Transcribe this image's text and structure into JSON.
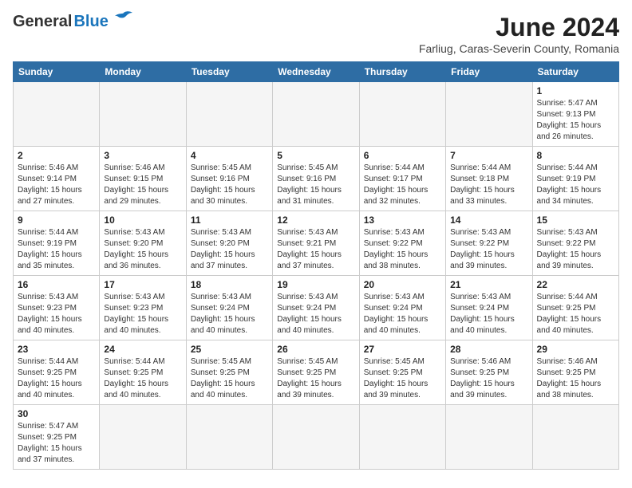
{
  "header": {
    "logo_general": "General",
    "logo_blue": "Blue",
    "month_title": "June 2024",
    "subtitle": "Farliug, Caras-Severin County, Romania"
  },
  "weekdays": [
    "Sunday",
    "Monday",
    "Tuesday",
    "Wednesday",
    "Thursday",
    "Friday",
    "Saturday"
  ],
  "weeks": [
    [
      {
        "day": "",
        "info": ""
      },
      {
        "day": "",
        "info": ""
      },
      {
        "day": "",
        "info": ""
      },
      {
        "day": "",
        "info": ""
      },
      {
        "day": "",
        "info": ""
      },
      {
        "day": "",
        "info": ""
      },
      {
        "day": "1",
        "info": "Sunrise: 5:47 AM\nSunset: 9:13 PM\nDaylight: 15 hours\nand 26 minutes."
      }
    ],
    [
      {
        "day": "2",
        "info": "Sunrise: 5:46 AM\nSunset: 9:14 PM\nDaylight: 15 hours\nand 27 minutes."
      },
      {
        "day": "3",
        "info": "Sunrise: 5:46 AM\nSunset: 9:15 PM\nDaylight: 15 hours\nand 29 minutes."
      },
      {
        "day": "4",
        "info": "Sunrise: 5:45 AM\nSunset: 9:16 PM\nDaylight: 15 hours\nand 30 minutes."
      },
      {
        "day": "5",
        "info": "Sunrise: 5:45 AM\nSunset: 9:16 PM\nDaylight: 15 hours\nand 31 minutes."
      },
      {
        "day": "6",
        "info": "Sunrise: 5:44 AM\nSunset: 9:17 PM\nDaylight: 15 hours\nand 32 minutes."
      },
      {
        "day": "7",
        "info": "Sunrise: 5:44 AM\nSunset: 9:18 PM\nDaylight: 15 hours\nand 33 minutes."
      },
      {
        "day": "8",
        "info": "Sunrise: 5:44 AM\nSunset: 9:19 PM\nDaylight: 15 hours\nand 34 minutes."
      }
    ],
    [
      {
        "day": "9",
        "info": "Sunrise: 5:44 AM\nSunset: 9:19 PM\nDaylight: 15 hours\nand 35 minutes."
      },
      {
        "day": "10",
        "info": "Sunrise: 5:43 AM\nSunset: 9:20 PM\nDaylight: 15 hours\nand 36 minutes."
      },
      {
        "day": "11",
        "info": "Sunrise: 5:43 AM\nSunset: 9:20 PM\nDaylight: 15 hours\nand 37 minutes."
      },
      {
        "day": "12",
        "info": "Sunrise: 5:43 AM\nSunset: 9:21 PM\nDaylight: 15 hours\nand 37 minutes."
      },
      {
        "day": "13",
        "info": "Sunrise: 5:43 AM\nSunset: 9:22 PM\nDaylight: 15 hours\nand 38 minutes."
      },
      {
        "day": "14",
        "info": "Sunrise: 5:43 AM\nSunset: 9:22 PM\nDaylight: 15 hours\nand 39 minutes."
      },
      {
        "day": "15",
        "info": "Sunrise: 5:43 AM\nSunset: 9:22 PM\nDaylight: 15 hours\nand 39 minutes."
      }
    ],
    [
      {
        "day": "16",
        "info": "Sunrise: 5:43 AM\nSunset: 9:23 PM\nDaylight: 15 hours\nand 40 minutes."
      },
      {
        "day": "17",
        "info": "Sunrise: 5:43 AM\nSunset: 9:23 PM\nDaylight: 15 hours\nand 40 minutes."
      },
      {
        "day": "18",
        "info": "Sunrise: 5:43 AM\nSunset: 9:24 PM\nDaylight: 15 hours\nand 40 minutes."
      },
      {
        "day": "19",
        "info": "Sunrise: 5:43 AM\nSunset: 9:24 PM\nDaylight: 15 hours\nand 40 minutes."
      },
      {
        "day": "20",
        "info": "Sunrise: 5:43 AM\nSunset: 9:24 PM\nDaylight: 15 hours\nand 40 minutes."
      },
      {
        "day": "21",
        "info": "Sunrise: 5:43 AM\nSunset: 9:24 PM\nDaylight: 15 hours\nand 40 minutes."
      },
      {
        "day": "22",
        "info": "Sunrise: 5:44 AM\nSunset: 9:25 PM\nDaylight: 15 hours\nand 40 minutes."
      }
    ],
    [
      {
        "day": "23",
        "info": "Sunrise: 5:44 AM\nSunset: 9:25 PM\nDaylight: 15 hours\nand 40 minutes."
      },
      {
        "day": "24",
        "info": "Sunrise: 5:44 AM\nSunset: 9:25 PM\nDaylight: 15 hours\nand 40 minutes."
      },
      {
        "day": "25",
        "info": "Sunrise: 5:45 AM\nSunset: 9:25 PM\nDaylight: 15 hours\nand 40 minutes."
      },
      {
        "day": "26",
        "info": "Sunrise: 5:45 AM\nSunset: 9:25 PM\nDaylight: 15 hours\nand 39 minutes."
      },
      {
        "day": "27",
        "info": "Sunrise: 5:45 AM\nSunset: 9:25 PM\nDaylight: 15 hours\nand 39 minutes."
      },
      {
        "day": "28",
        "info": "Sunrise: 5:46 AM\nSunset: 9:25 PM\nDaylight: 15 hours\nand 39 minutes."
      },
      {
        "day": "29",
        "info": "Sunrise: 5:46 AM\nSunset: 9:25 PM\nDaylight: 15 hours\nand 38 minutes."
      }
    ],
    [
      {
        "day": "30",
        "info": "Sunrise: 5:47 AM\nSunset: 9:25 PM\nDaylight: 15 hours\nand 37 minutes."
      },
      {
        "day": "",
        "info": ""
      },
      {
        "day": "",
        "info": ""
      },
      {
        "day": "",
        "info": ""
      },
      {
        "day": "",
        "info": ""
      },
      {
        "day": "",
        "info": ""
      },
      {
        "day": "",
        "info": ""
      }
    ]
  ]
}
